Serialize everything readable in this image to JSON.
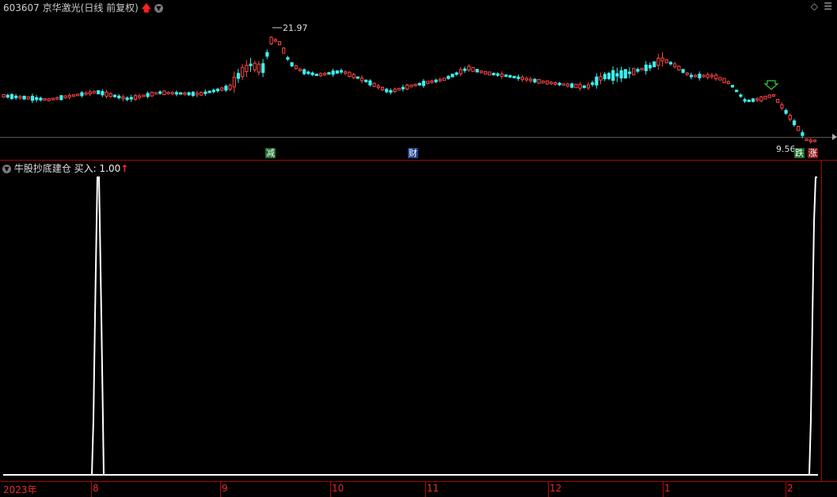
{
  "header": {
    "code": "603607",
    "name": "京华激光",
    "period": "(日线 前复权)",
    "up_arrow": "up-arrow-icon",
    "dropdown": "chevron-down-icon",
    "diamond": "diamond-icon",
    "menu": "menu-icon"
  },
  "price_panel": {
    "high_label": "21.97",
    "low_label": "9.56",
    "events": [
      {
        "label": "减",
        "color": "#35c06a"
      },
      {
        "label": "财",
        "color": "#6aa0ff"
      },
      {
        "label": "跌",
        "color": "#35c06a"
      },
      {
        "label": "涨",
        "color": "#ff4040"
      }
    ]
  },
  "indicator": {
    "name": "牛股抄底建仓",
    "buy_label": "买入: 1.00",
    "arrow": "up-arrow-icon"
  },
  "x_axis": {
    "labels": [
      "2023年",
      "8",
      "9",
      "10",
      "11",
      "12",
      "1",
      "2"
    ]
  },
  "colors": {
    "up": "#ff4545",
    "down": "#3ef0f0",
    "grid": "#8b0000",
    "axis_red": "#c00000",
    "signal": "#ffffff"
  }
}
